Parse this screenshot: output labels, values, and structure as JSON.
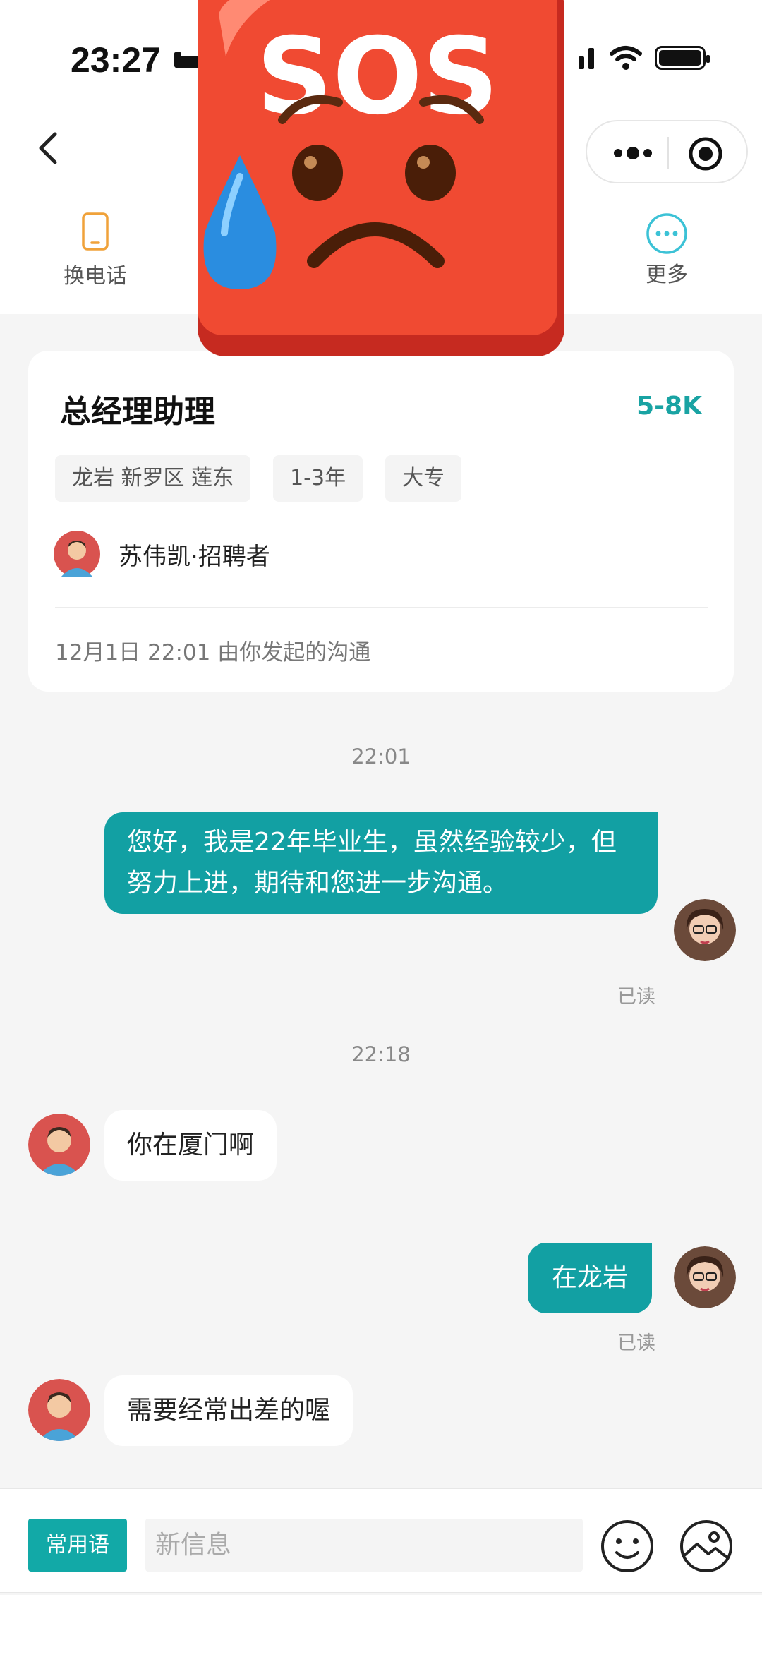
{
  "status_bar": {
    "time": "23:27"
  },
  "toolbar": {
    "items": [
      {
        "label": "换电话",
        "icon": "phone-icon"
      },
      {
        "label": "更多",
        "icon": "more-circle-icon"
      }
    ]
  },
  "sticker": {
    "text": "SOS",
    "icon": "sos-sad-sticker"
  },
  "job": {
    "title": "总经理助理",
    "salary": "5-8K",
    "tags": [
      "龙岩 新罗区 莲东",
      "1-3年",
      "大专"
    ],
    "recruiter": "苏伟凯·招聘者",
    "meta": "12月1日  22:01 由你发起的沟通"
  },
  "messages": [
    {
      "time": "22:01"
    },
    {
      "from": "me",
      "text": "您好，我是22年毕业生，虽然经验较少，但努力上进，期待和您进一步沟通。",
      "status": "已读"
    },
    {
      "time": "22:18"
    },
    {
      "from": "recruiter",
      "text": "你在厦门啊"
    },
    {
      "from": "me",
      "text": "在龙岩",
      "status": "已读"
    },
    {
      "from": "recruiter",
      "text": "需要经常出差的喔"
    }
  ],
  "input": {
    "phrases_label": "常用语",
    "placeholder": "新信息",
    "value": ""
  },
  "colors": {
    "accent": "#12a0a3",
    "salary": "#19a3a3",
    "background": "#f5f5f5"
  }
}
